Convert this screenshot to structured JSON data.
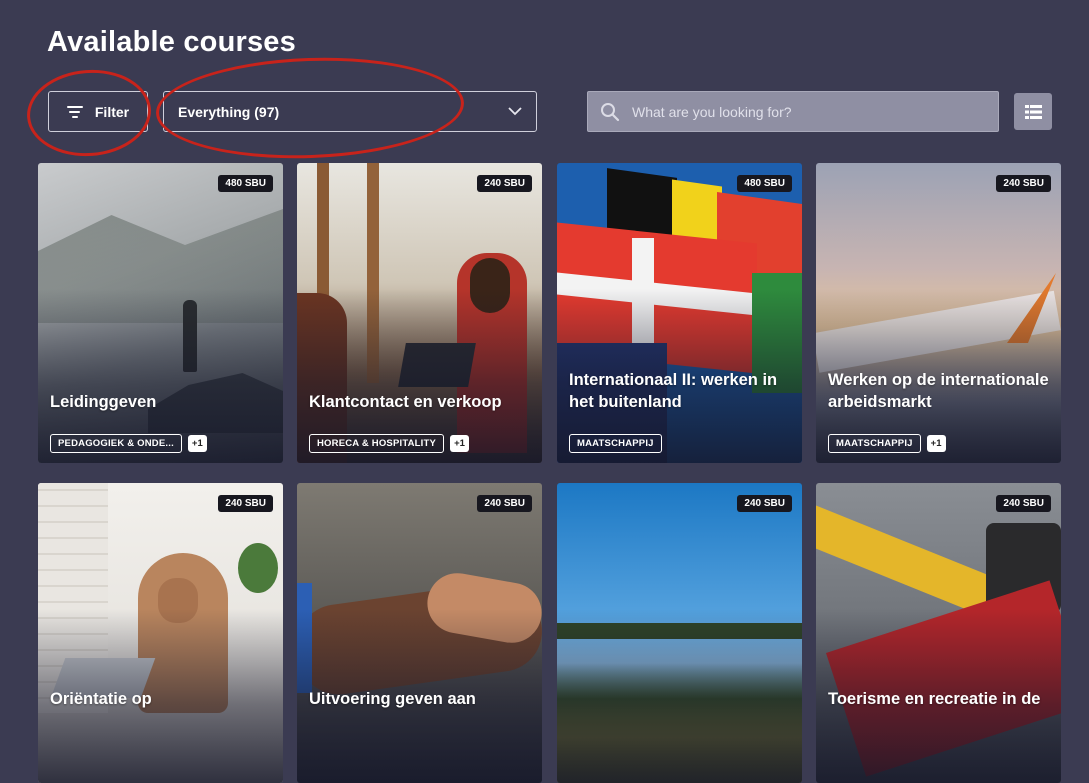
{
  "page": {
    "title": "Available courses"
  },
  "toolbar": {
    "filter_label": "Filter",
    "dropdown_value": "Everything (97)",
    "search_placeholder": "What are you looking for?",
    "view_toggle_icon": "list-icon"
  },
  "annotations_color": "#c8231b",
  "courses": [
    {
      "title": "Leidinggeven",
      "credits": "480 SBU",
      "tags": [
        "PEDAGOGIEK & ONDE..."
      ],
      "extra_tags": "+1"
    },
    {
      "title": "Klantcontact en verkoop",
      "credits": "240 SBU",
      "tags": [
        "HORECA & HOSPITALITY"
      ],
      "extra_tags": "+1"
    },
    {
      "title": "Internationaal II: werken in het buitenland",
      "credits": "480 SBU",
      "tags": [
        "MAATSCHAPPIJ"
      ],
      "extra_tags": ""
    },
    {
      "title": "Werken op de internationale arbeidsmarkt",
      "credits": "240 SBU",
      "tags": [
        "MAATSCHAPPIJ"
      ],
      "extra_tags": "+1"
    },
    {
      "title": "Oriëntatie op",
      "credits": "240 SBU",
      "tags": [],
      "extra_tags": ""
    },
    {
      "title": "Uitvoering geven aan",
      "credits": "240 SBU",
      "tags": [],
      "extra_tags": ""
    },
    {
      "title": "",
      "credits": "240 SBU",
      "tags": [],
      "extra_tags": ""
    },
    {
      "title": "Toerisme en recreatie in de",
      "credits": "240 SBU",
      "tags": [],
      "extra_tags": ""
    }
  ]
}
